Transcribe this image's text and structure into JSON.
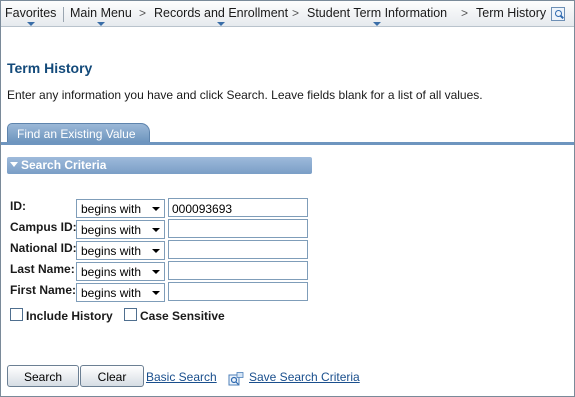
{
  "breadcrumb": {
    "items": [
      {
        "label": "Favorites"
      },
      {
        "label": "Main Menu"
      },
      {
        "label": "Records and Enrollment"
      },
      {
        "label": "Student Term Information"
      },
      {
        "label": "Term History"
      }
    ],
    "separator": ">"
  },
  "page": {
    "title": "Term History",
    "instructions": "Enter any information you have and click Search. Leave fields blank for a list of all values."
  },
  "tabs": [
    {
      "label": "Find an Existing Value"
    }
  ],
  "section": {
    "title": "Search Criteria"
  },
  "criteria": [
    {
      "label": "ID:",
      "operator": "begins with",
      "value": "000093693"
    },
    {
      "label": "Campus ID:",
      "operator": "begins with",
      "value": ""
    },
    {
      "label": "National ID:",
      "operator": "begins with",
      "value": ""
    },
    {
      "label": "Last Name:",
      "operator": "begins with",
      "value": ""
    },
    {
      "label": "First Name:",
      "operator": "begins with",
      "value": ""
    }
  ],
  "options": {
    "include_history": {
      "label": "Include History",
      "checked": false
    },
    "case_sensitive": {
      "label": "Case Sensitive",
      "checked": false
    }
  },
  "actions": {
    "search": "Search",
    "clear": "Clear",
    "basic_search": "Basic Search",
    "save_criteria": "Save Search Criteria"
  },
  "colors": {
    "title": "#134a7a",
    "tab": "#6b93bd",
    "link": "#1a4f8d"
  }
}
